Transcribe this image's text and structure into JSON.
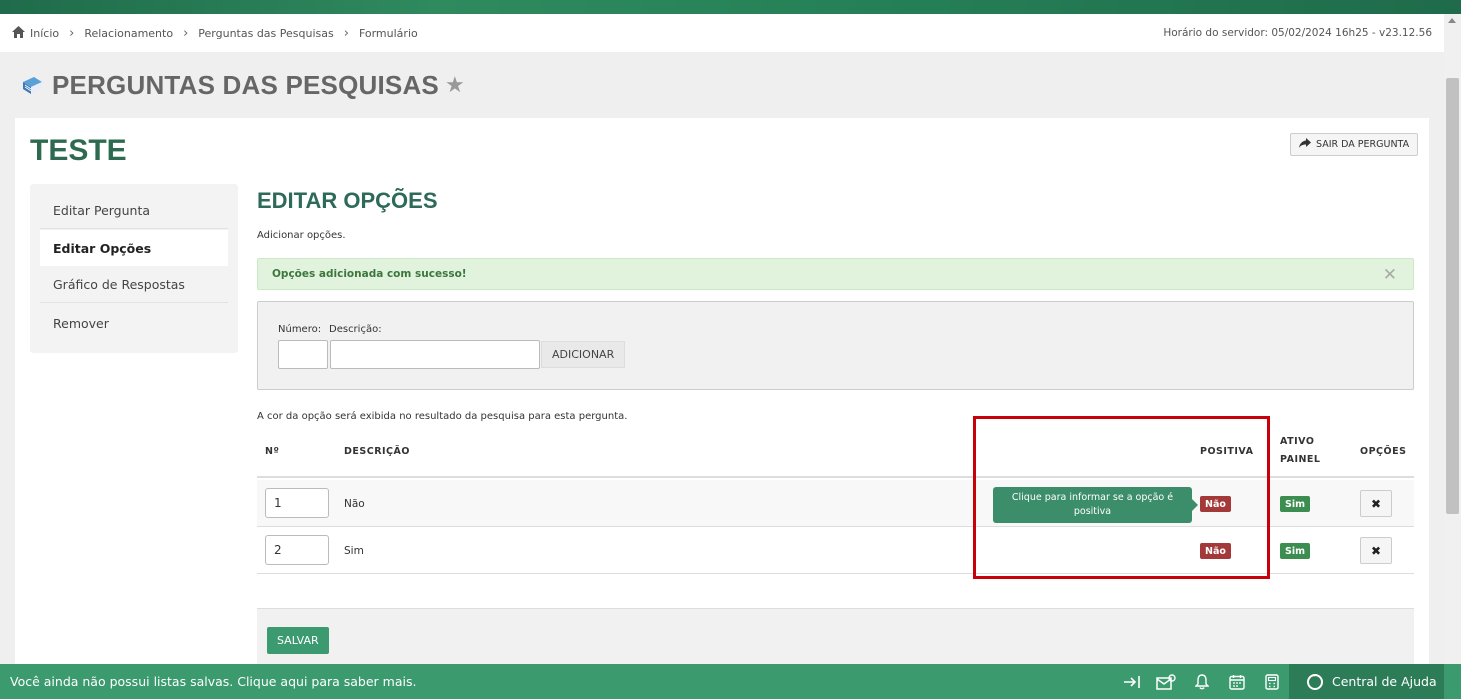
{
  "breadcrumb": [
    "Início",
    "Relacionamento",
    "Perguntas das Pesquisas",
    "Formulário"
  ],
  "server_time": "Horário do servidor: 05/02/2024 16h25 - v23.12.56",
  "page_title": "PERGUNTAS DAS PESQUISAS",
  "card": {
    "title": "TESTE",
    "exit_button": "SAIR DA PERGUNTA"
  },
  "sidemenu": {
    "items": [
      "Editar Pergunta",
      "Editar Opções",
      "Gráfico de Respostas",
      "Remover"
    ],
    "active": "Editar Opções"
  },
  "section": {
    "title": "EDITAR OPÇÕES",
    "subtitle": "Adicionar opções."
  },
  "alert": {
    "message": "Opções adicionada com sucesso!",
    "close": "✕"
  },
  "form": {
    "numero_label": "Número:",
    "descricao_label": "Descrição:",
    "numero_value": "",
    "descricao_value": "",
    "add_button": "ADICIONAR"
  },
  "hint": "A cor da opção será exibida no resultado da pesquisa para esta pergunta.",
  "table": {
    "headers": {
      "numero": "Nº",
      "descricao": "DESCRIÇÃO",
      "positiva": "POSITIVA",
      "ativo_painel_1": "ATIVO",
      "ativo_painel_2": "PAINEL",
      "opcoes": "OPÇÕES"
    },
    "rows": [
      {
        "numero": "1",
        "descricao": "Não",
        "positiva": "Não",
        "ativo": "Sim"
      },
      {
        "numero": "2",
        "descricao": "Sim",
        "positiva": "Não",
        "ativo": "Sim"
      }
    ],
    "tooltip": "Clique para informar se a opção é positiva"
  },
  "save_button": "SALVAR",
  "bottom_bar": {
    "message": "Você ainda não possui listas salvas. Clique aqui para saber mais.",
    "help": "Central de Ajuda"
  },
  "colors": {
    "brand_green": "#3b9a6e",
    "title_green": "#2d6a4f",
    "badge_red": "#a4393a",
    "badge_green": "#3c8d50",
    "highlight": "#c8000a"
  }
}
